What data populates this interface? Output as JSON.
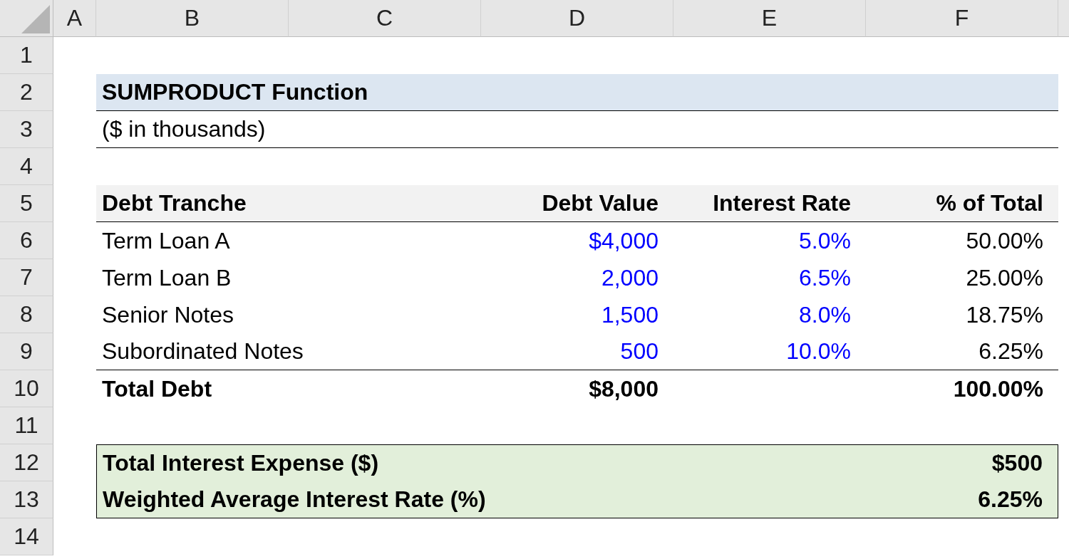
{
  "column_headers": [
    "A",
    "B",
    "C",
    "D",
    "E",
    "F"
  ],
  "row_numbers": [
    "1",
    "2",
    "3",
    "4",
    "5",
    "6",
    "7",
    "8",
    "9",
    "10",
    "11",
    "12",
    "13",
    "14"
  ],
  "title": "SUMPRODUCT Function",
  "subtitle": "($ in thousands)",
  "table": {
    "columns": [
      {
        "label": "Debt Tranche",
        "kind": "label"
      },
      {
        "label": "Debt Value",
        "kind": "input"
      },
      {
        "label": "Interest Rate",
        "kind": "input"
      },
      {
        "label": "% of Total",
        "kind": "formula"
      }
    ],
    "rows": [
      {
        "cells": [
          "Term Loan A",
          "$4,000",
          "5.0%",
          "50.00%"
        ]
      },
      {
        "cells": [
          "Term Loan B",
          "2,000",
          "6.5%",
          "25.00%"
        ]
      },
      {
        "cells": [
          "Senior Notes",
          "1,500",
          "8.0%",
          "18.75%"
        ]
      },
      {
        "cells": [
          "Subordinated Notes",
          "500",
          "10.0%",
          "6.25%"
        ]
      }
    ],
    "total": {
      "cells": [
        "Total Debt",
        "$8,000",
        "",
        "100.00%"
      ]
    }
  },
  "summary": [
    {
      "label": "Total Interest Expense ($)",
      "value": "$500"
    },
    {
      "label": "Weighted Average Interest Rate (%)",
      "value": "6.25%"
    }
  ]
}
